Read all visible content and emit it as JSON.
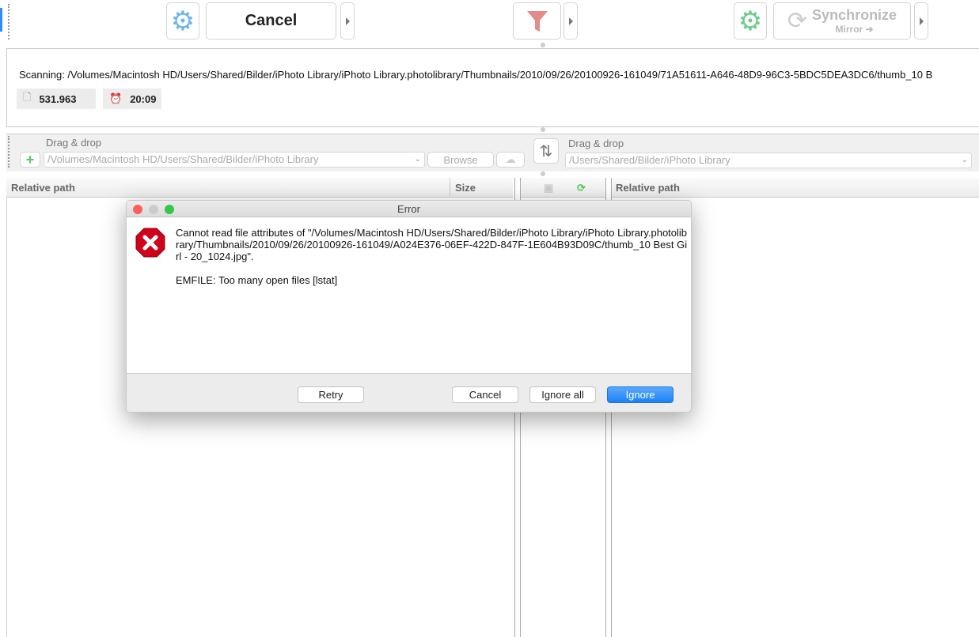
{
  "toolbar": {
    "cancel_label": "Cancel",
    "sync_label": "Synchronize",
    "sync_sub": "Mirror ➜"
  },
  "status": {
    "scanning": "Scanning: /Volumes/Macintosh HD/Users/Shared/Bilder/iPhoto Library/iPhoto Library.photolibrary/Thumbnails/2010/09/26/20100926-161049/71A51611-A646-48D9-96C3-5BDC5DEA3DC6/thumb_10 B",
    "items_count": "531.963",
    "elapsed": "20:09"
  },
  "left": {
    "drag_label": "Drag & drop",
    "path": "/Volumes/Macintosh HD/Users/Shared/Bilder/iPhoto Library",
    "browse": "Browse"
  },
  "right": {
    "drag_label": "Drag & drop",
    "path": "/Users/Shared/Bilder/iPhoto Library"
  },
  "grid": {
    "left_col_path": "Relative path",
    "left_col_size": "Size",
    "right_col_path": "Relative path"
  },
  "dialog": {
    "title": "Error",
    "message": "Cannot read file attributes of \"/Volumes/Macintosh HD/Users/Shared/Bilder/iPhoto Library/iPhoto Library.photolibrary/Thumbnails/2010/09/26/20100926-161049/A024E376-06EF-422D-847F-1E604B93D09C/thumb_10 Best Girl - 20_1024.jpg\".",
    "detail": "EMFILE: Too many open files [lstat]",
    "retry": "Retry",
    "cancel": "Cancel",
    "ignore_all": "Ignore all",
    "ignore": "Ignore"
  },
  "colors": {
    "accent": "#2f8df7",
    "error": "#d0021b"
  }
}
